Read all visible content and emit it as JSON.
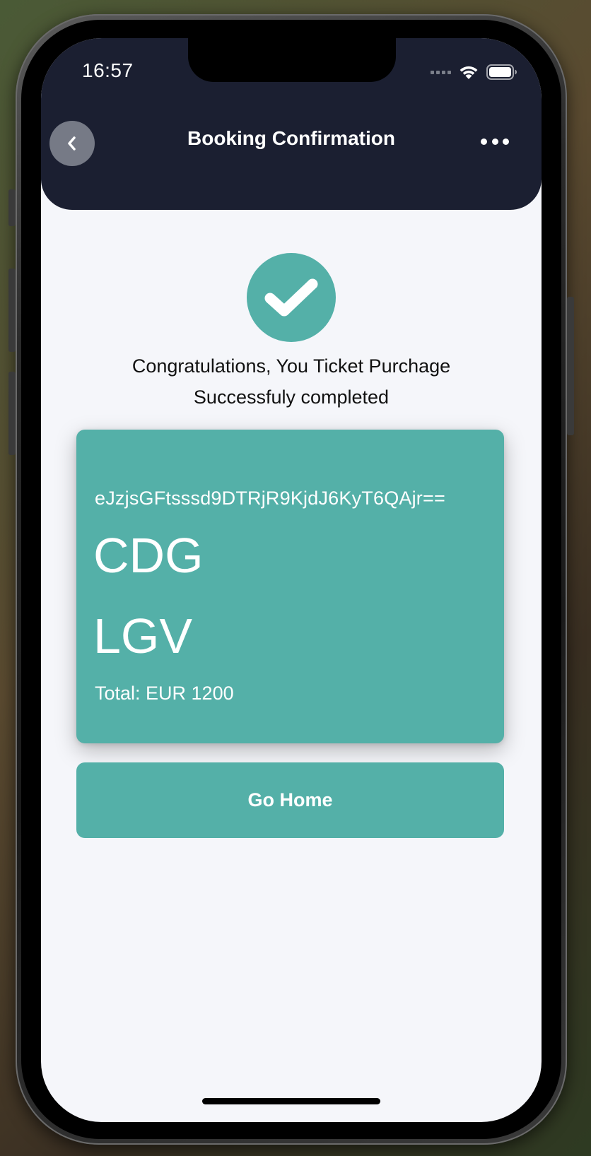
{
  "status_bar": {
    "time": "16:57"
  },
  "header": {
    "title": "Booking Confirmation",
    "back_icon": "chevron-left-icon",
    "more_icon": "ellipsis-icon",
    "background_color": "#1b1f31"
  },
  "confirmation": {
    "icon": "checkmark-icon",
    "message_line1": "Congratulations, You Ticket Purchage",
    "message_line2": "Successfuly completed"
  },
  "ticket": {
    "code": "eJzjsGFtsssd9DTRjR9KjdJ6KyT6QAjr==",
    "origin": "CDG",
    "destination": "LGV",
    "total": "Total: EUR 1200",
    "card_color": "#54b0a8"
  },
  "actions": {
    "go_home_label": "Go Home"
  }
}
